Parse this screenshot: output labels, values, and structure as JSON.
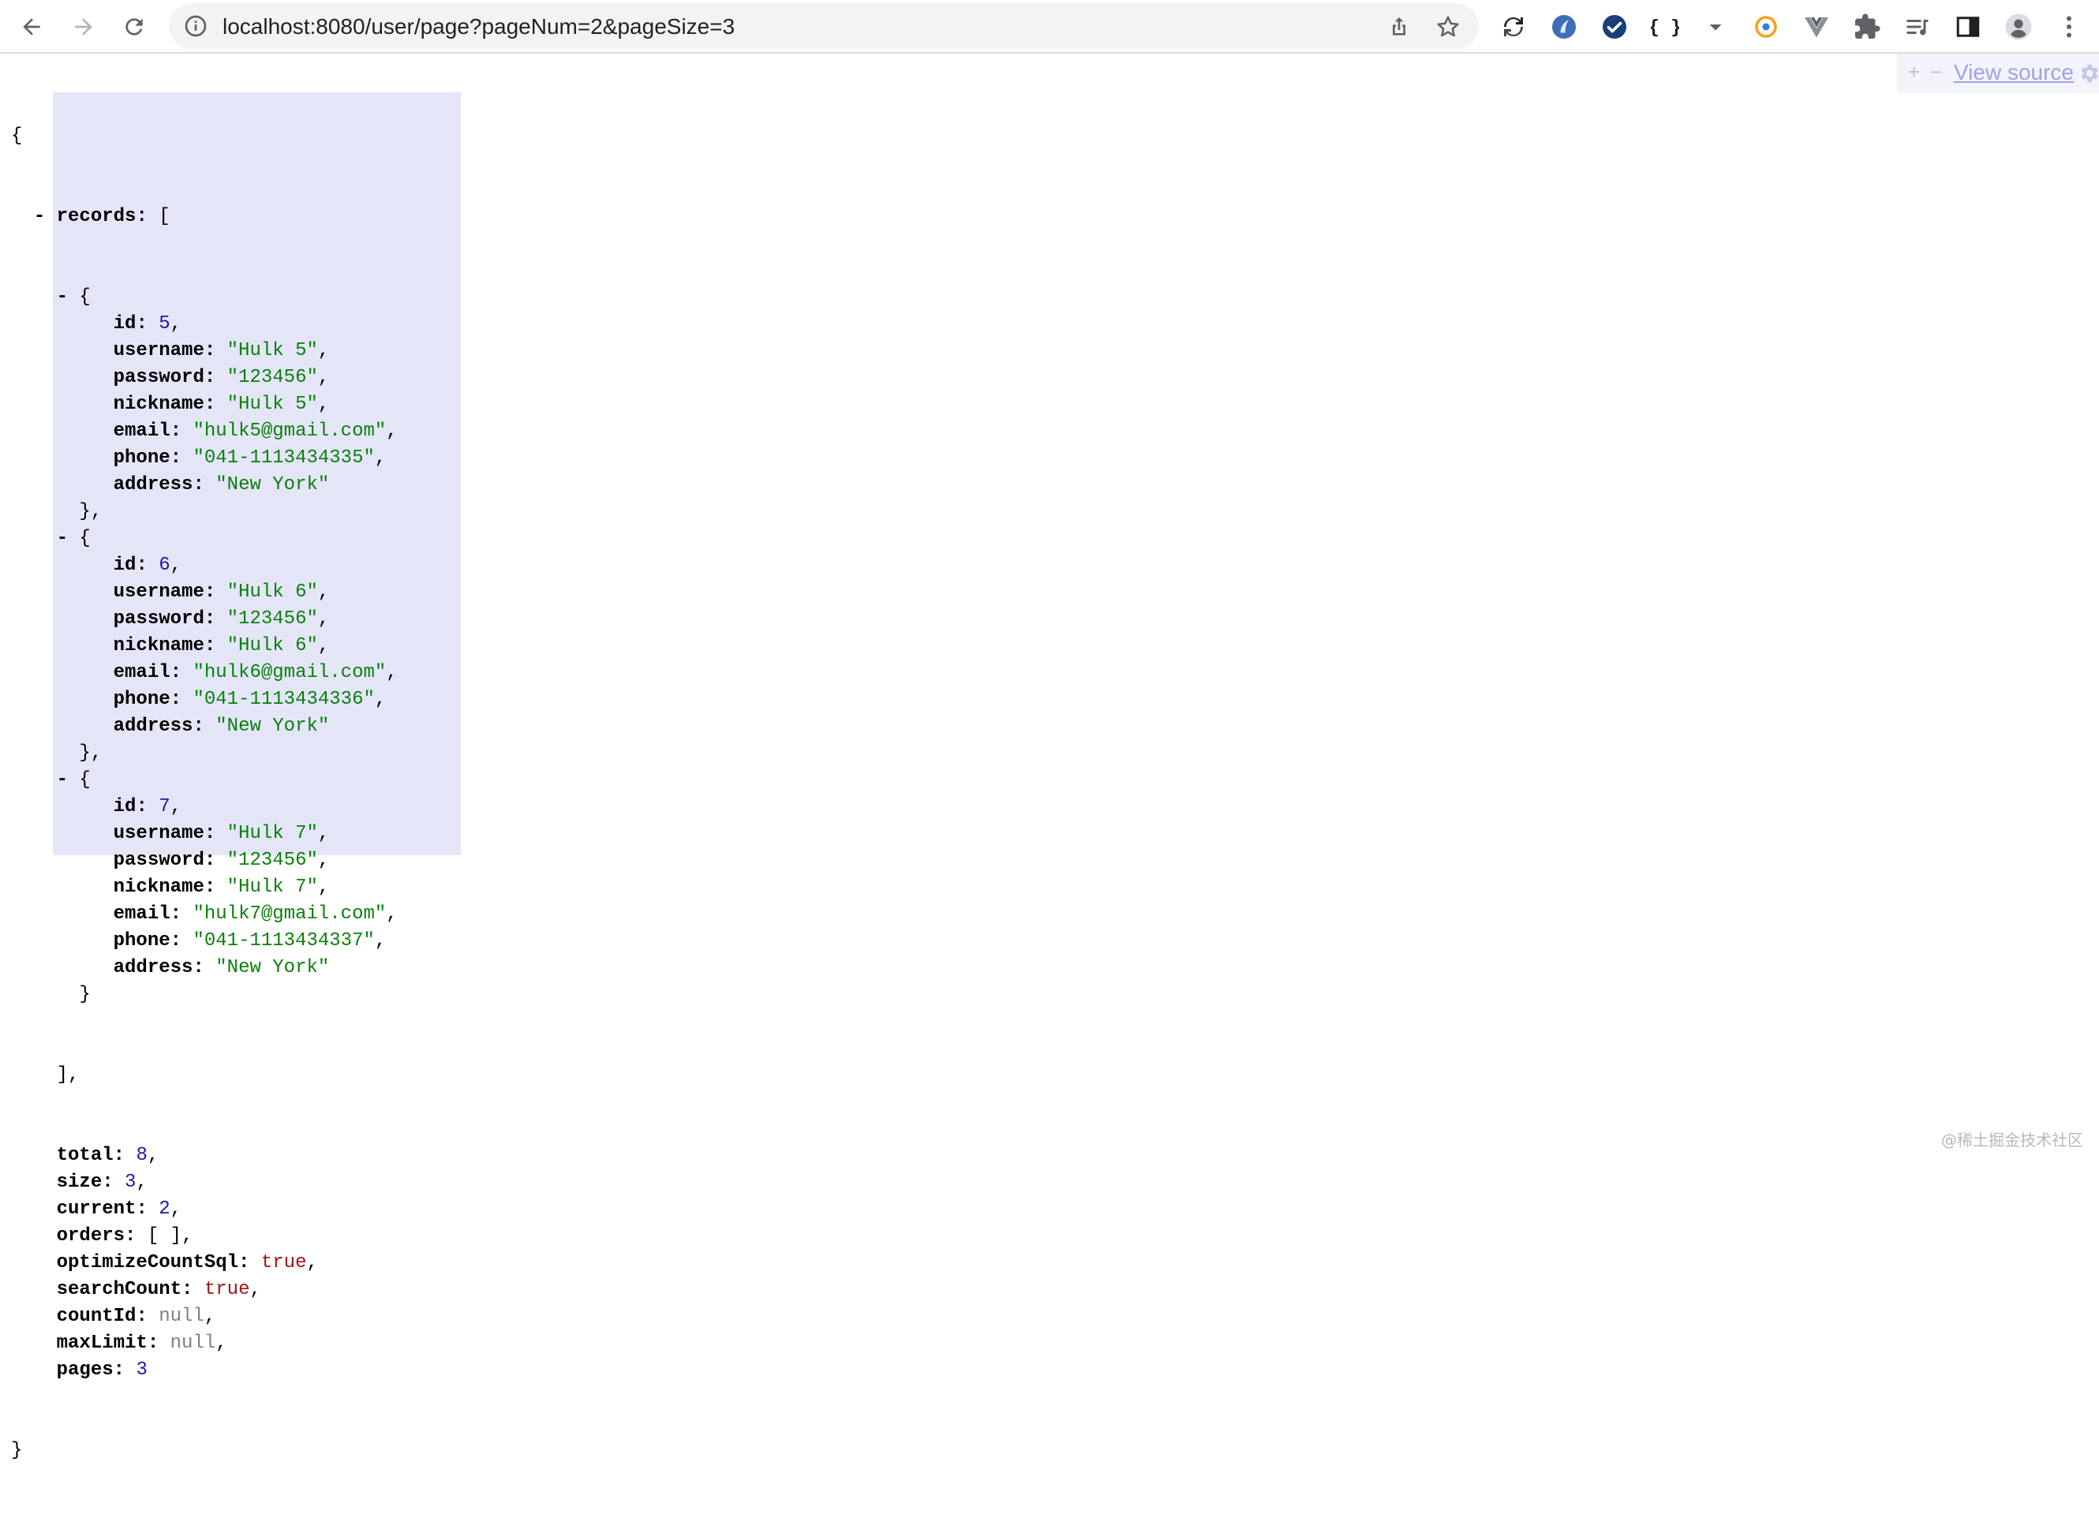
{
  "browser": {
    "url": "localhost:8080/user/page?pageNum=2&pageSize=3",
    "icons": {
      "back": "arrow-left-icon",
      "forward": "arrow-right-icon",
      "reload": "reload-icon",
      "info": "info-icon",
      "share": "share-icon",
      "bookmark": "star-icon"
    },
    "extensions": [
      "sync-icon",
      "feather-extension-icon",
      "check-extension-icon",
      "json-extension-icon",
      "dropdown-icon",
      "coin-extension-icon",
      "vue-icon",
      "puzzle-icon",
      "reading-list-icon",
      "side-panel-icon",
      "profile-icon",
      "kebab-menu-icon"
    ]
  },
  "viewer": {
    "plus": "+",
    "minus": "−",
    "view_source": "View source"
  },
  "json": {
    "open_brace": "{",
    "close_brace": "}",
    "records_key": "records",
    "records_open": "[",
    "records_close": "],",
    "collapse_toggle": "-",
    "records": [
      {
        "id": "5",
        "username": "\"Hulk 5\"",
        "password": "\"123456\"",
        "nickname": "\"Hulk 5\"",
        "email": "\"hulk5@gmail.com\"",
        "phone": "\"041-1113434335\"",
        "address": "\"New York\""
      },
      {
        "id": "6",
        "username": "\"Hulk 6\"",
        "password": "\"123456\"",
        "nickname": "\"Hulk 6\"",
        "email": "\"hulk6@gmail.com\"",
        "phone": "\"041-1113434336\"",
        "address": "\"New York\""
      },
      {
        "id": "7",
        "username": "\"Hulk 7\"",
        "password": "\"123456\"",
        "nickname": "\"Hulk 7\"",
        "email": "\"hulk7@gmail.com\"",
        "phone": "\"041-1113434337\"",
        "address": "\"New York\""
      }
    ],
    "record_keys": [
      "id",
      "username",
      "password",
      "nickname",
      "email",
      "phone",
      "address"
    ],
    "tail": [
      {
        "key": "total",
        "value": "8",
        "kind": "n"
      },
      {
        "key": "size",
        "value": "3",
        "kind": "n"
      },
      {
        "key": "current",
        "value": "2",
        "kind": "n"
      },
      {
        "key": "orders",
        "value": "[ ]",
        "kind": "plain"
      },
      {
        "key": "optimizeCountSql",
        "value": "true",
        "kind": "b"
      },
      {
        "key": "searchCount",
        "value": "true",
        "kind": "b"
      },
      {
        "key": "countId",
        "value": "null",
        "kind": "nl"
      },
      {
        "key": "maxLimit",
        "value": "null",
        "kind": "nl"
      },
      {
        "key": "pages",
        "value": "3",
        "kind": "n"
      }
    ]
  },
  "watermark": "@稀土掘金技术社区"
}
